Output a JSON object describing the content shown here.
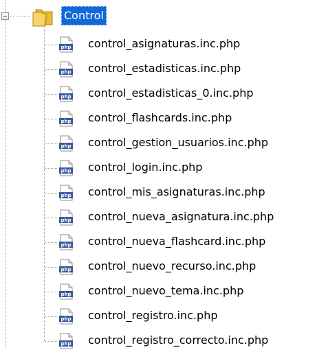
{
  "tree": {
    "root": {
      "label": "Control",
      "icon": "folder-icon",
      "expanded": true,
      "selected": true
    },
    "items": [
      {
        "label": "control_asignaturas.inc.php",
        "icon": "php-file-icon"
      },
      {
        "label": "control_estadisticas.inc.php",
        "icon": "php-file-icon"
      },
      {
        "label": "control_estadisticas_0.inc.php",
        "icon": "php-file-icon"
      },
      {
        "label": "control_flashcards.inc.php",
        "icon": "php-file-icon"
      },
      {
        "label": "control_gestion_usuarios.inc.php",
        "icon": "php-file-icon"
      },
      {
        "label": "control_login.inc.php",
        "icon": "php-file-icon"
      },
      {
        "label": "control_mis_asignaturas.inc.php",
        "icon": "php-file-icon"
      },
      {
        "label": "control_nueva_asignatura.inc.php",
        "icon": "php-file-icon"
      },
      {
        "label": "control_nueva_flashcard.inc.php",
        "icon": "php-file-icon"
      },
      {
        "label": "control_nuevo_recurso.inc.php",
        "icon": "php-file-icon"
      },
      {
        "label": "control_nuevo_tema.inc.php",
        "icon": "php-file-icon"
      },
      {
        "label": "control_registro.inc.php",
        "icon": "php-file-icon"
      },
      {
        "label": "control_registro_correcto.inc.php",
        "icon": "php-file-icon"
      }
    ]
  },
  "colors": {
    "selection": "#1168d6",
    "selection_text": "#ffffff",
    "connector": "#a0a0a0",
    "folder": "#f2c94c",
    "php_badge": "#3a5a9a"
  }
}
